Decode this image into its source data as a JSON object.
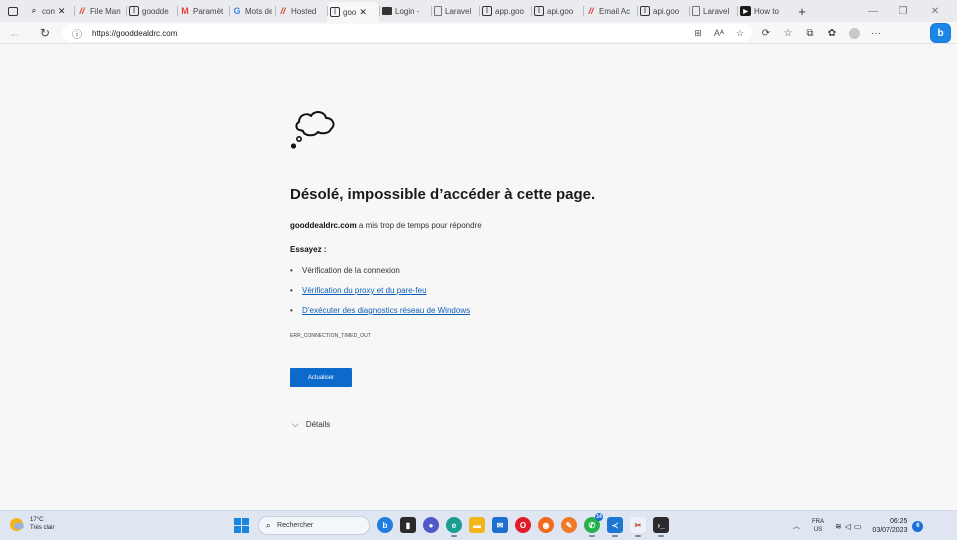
{
  "browser": {
    "tabs": [
      {
        "title": "con",
        "icon": "search-icon",
        "closable": true
      },
      {
        "title": "File Man",
        "icon": "hostinger-icon"
      },
      {
        "title": "goodde",
        "icon": "page-icon"
      },
      {
        "title": "Paramèt",
        "icon": "gmail-icon"
      },
      {
        "title": "Mots de",
        "icon": "google-icon"
      },
      {
        "title": "Hosted",
        "icon": "hostinger-icon"
      },
      {
        "title": "goo",
        "icon": "page-icon",
        "active": true,
        "closable": true
      },
      {
        "title": "Login -",
        "icon": "terminal-icon"
      },
      {
        "title": "Laravel",
        "icon": "document-icon"
      },
      {
        "title": "app.goo",
        "icon": "page-icon"
      },
      {
        "title": "api.goo",
        "icon": "page-icon"
      },
      {
        "title": "Email Ac",
        "icon": "hostinger-icon"
      },
      {
        "title": "api.goo",
        "icon": "page-icon"
      },
      {
        "title": "Laravel",
        "icon": "document-icon"
      },
      {
        "title": "How to",
        "icon": "video-icon"
      }
    ],
    "address": {
      "url": "https://gooddealdrc.com"
    }
  },
  "error_page": {
    "title": "Désolé, impossible d’accéder à cette page.",
    "domain": "gooddealdrc.com",
    "message": "a mis trop de temps pour répondre",
    "try_heading": "Essayez :",
    "suggestions": [
      {
        "text": "Vérification de la connexion",
        "link": false
      },
      {
        "text": "Vérification du proxy et du pare-feu",
        "link": true
      },
      {
        "text": "D’exécuter des diagnostics réseau de Windows",
        "link": true
      }
    ],
    "error_code": "ERR_CONNECTION_TIMED_OUT",
    "refresh_label": "Actualiser",
    "details_label": "Détails"
  },
  "taskbar": {
    "weather": {
      "temp": "17°C",
      "desc": "Très clair"
    },
    "search_placeholder": "Rechercher",
    "whatsapp_badge": "14",
    "lang_top": "FRA",
    "lang_bottom": "US",
    "time": "06:25",
    "date": "03/07/2023",
    "notification_count": "6"
  },
  "colors": {
    "accent": "#0b6acb",
    "link": "#0f5fb5",
    "taskbar": "#dfe6f1"
  }
}
